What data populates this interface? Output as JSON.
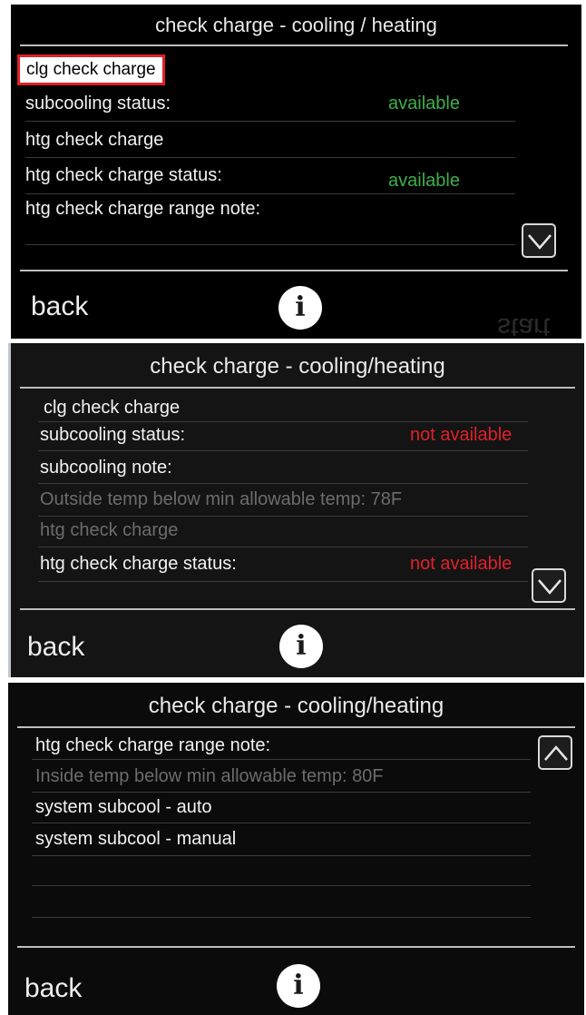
{
  "screen1": {
    "title": "check charge - cooling / heating",
    "rows": [
      {
        "label": "clg check charge",
        "value": ""
      },
      {
        "label": "subcooling status:",
        "value": "available"
      },
      {
        "label": "htg check charge",
        "value": ""
      },
      {
        "label": "htg check charge status:",
        "value": "available"
      },
      {
        "label": "htg check charge range note:",
        "value": ""
      }
    ],
    "back_label": "back",
    "info_glyph": "i",
    "ghost_text": "start",
    "scroll_button": "chevron-down-icon"
  },
  "screen2": {
    "title": "check charge - cooling/heating",
    "rows": [
      {
        "label": "clg check charge",
        "value": ""
      },
      {
        "label": "subcooling status:",
        "value": "not available"
      },
      {
        "label": "subcooling note:",
        "value": ""
      },
      {
        "label": "Outside temp below min allowable temp: 78F",
        "value": ""
      },
      {
        "label": "htg check charge",
        "value": ""
      },
      {
        "label": "htg check charge status:",
        "value": "not available"
      }
    ],
    "back_label": "back",
    "info_glyph": "i",
    "scroll_button": "chevron-down-icon"
  },
  "screen3": {
    "title": "check charge - cooling/heating",
    "rows": [
      {
        "label": "htg check charge range note:"
      },
      {
        "label": "Inside temp below min allowable temp: 80F"
      },
      {
        "label": "system subcool - auto"
      },
      {
        "label": "system subcool - manual"
      }
    ],
    "back_label": "back",
    "info_glyph": "i",
    "scroll_button": "chevron-up-icon"
  },
  "colors": {
    "available": "#3fae4a",
    "not_available": "#e0202a",
    "highlight_border": "#e01f26",
    "dim_text": "#6c6c6c"
  }
}
